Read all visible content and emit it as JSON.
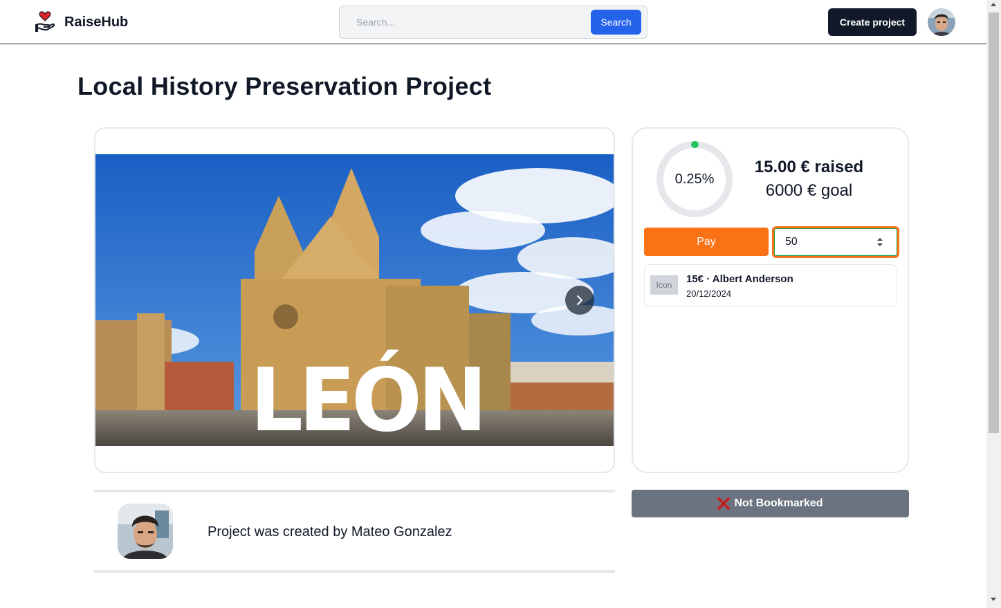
{
  "header": {
    "brand": "RaiseHub",
    "search_placeholder": "Search...",
    "search_button": "Search",
    "create_button": "Create project"
  },
  "project": {
    "title": "Local History Preservation Project",
    "image_caption": "LEÓN"
  },
  "funding": {
    "progress_fraction": 0.0025,
    "progress_text": "0.25%",
    "raised_text": "15.00 € raised",
    "goal_text": "6000 € goal",
    "pay_button": "Pay",
    "amount_value": "50",
    "donations": [
      {
        "icon_label": "Icon",
        "summary": "15€ · Albert Anderson",
        "date": "20/12/2024"
      }
    ]
  },
  "creator": {
    "text": "Project was created by Mateo Gonzalez"
  },
  "bookmark": {
    "label": "Not Bookmarked"
  },
  "colors": {
    "primary": "#2563eb",
    "dark": "#111827",
    "pay": "#f97316",
    "progress_dot": "#22c55e",
    "bookmark": "#6b7280"
  }
}
